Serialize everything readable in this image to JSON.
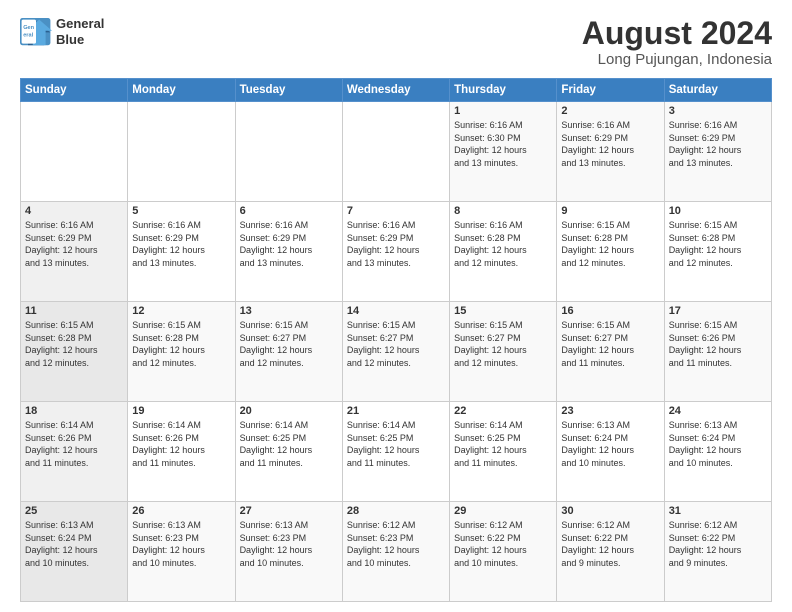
{
  "logo": {
    "line1": "General",
    "line2": "Blue"
  },
  "title": "August 2024",
  "subtitle": "Long Pujungan, Indonesia",
  "days_header": [
    "Sunday",
    "Monday",
    "Tuesday",
    "Wednesday",
    "Thursday",
    "Friday",
    "Saturday"
  ],
  "weeks": [
    [
      {
        "day": "",
        "info": ""
      },
      {
        "day": "",
        "info": ""
      },
      {
        "day": "",
        "info": ""
      },
      {
        "day": "",
        "info": ""
      },
      {
        "day": "1",
        "info": "Sunrise: 6:16 AM\nSunset: 6:30 PM\nDaylight: 12 hours\nand 13 minutes."
      },
      {
        "day": "2",
        "info": "Sunrise: 6:16 AM\nSunset: 6:29 PM\nDaylight: 12 hours\nand 13 minutes."
      },
      {
        "day": "3",
        "info": "Sunrise: 6:16 AM\nSunset: 6:29 PM\nDaylight: 12 hours\nand 13 minutes."
      }
    ],
    [
      {
        "day": "4",
        "info": "Sunrise: 6:16 AM\nSunset: 6:29 PM\nDaylight: 12 hours\nand 13 minutes."
      },
      {
        "day": "5",
        "info": "Sunrise: 6:16 AM\nSunset: 6:29 PM\nDaylight: 12 hours\nand 13 minutes."
      },
      {
        "day": "6",
        "info": "Sunrise: 6:16 AM\nSunset: 6:29 PM\nDaylight: 12 hours\nand 13 minutes."
      },
      {
        "day": "7",
        "info": "Sunrise: 6:16 AM\nSunset: 6:29 PM\nDaylight: 12 hours\nand 13 minutes."
      },
      {
        "day": "8",
        "info": "Sunrise: 6:16 AM\nSunset: 6:28 PM\nDaylight: 12 hours\nand 12 minutes."
      },
      {
        "day": "9",
        "info": "Sunrise: 6:15 AM\nSunset: 6:28 PM\nDaylight: 12 hours\nand 12 minutes."
      },
      {
        "day": "10",
        "info": "Sunrise: 6:15 AM\nSunset: 6:28 PM\nDaylight: 12 hours\nand 12 minutes."
      }
    ],
    [
      {
        "day": "11",
        "info": "Sunrise: 6:15 AM\nSunset: 6:28 PM\nDaylight: 12 hours\nand 12 minutes."
      },
      {
        "day": "12",
        "info": "Sunrise: 6:15 AM\nSunset: 6:28 PM\nDaylight: 12 hours\nand 12 minutes."
      },
      {
        "day": "13",
        "info": "Sunrise: 6:15 AM\nSunset: 6:27 PM\nDaylight: 12 hours\nand 12 minutes."
      },
      {
        "day": "14",
        "info": "Sunrise: 6:15 AM\nSunset: 6:27 PM\nDaylight: 12 hours\nand 12 minutes."
      },
      {
        "day": "15",
        "info": "Sunrise: 6:15 AM\nSunset: 6:27 PM\nDaylight: 12 hours\nand 12 minutes."
      },
      {
        "day": "16",
        "info": "Sunrise: 6:15 AM\nSunset: 6:27 PM\nDaylight: 12 hours\nand 11 minutes."
      },
      {
        "day": "17",
        "info": "Sunrise: 6:15 AM\nSunset: 6:26 PM\nDaylight: 12 hours\nand 11 minutes."
      }
    ],
    [
      {
        "day": "18",
        "info": "Sunrise: 6:14 AM\nSunset: 6:26 PM\nDaylight: 12 hours\nand 11 minutes."
      },
      {
        "day": "19",
        "info": "Sunrise: 6:14 AM\nSunset: 6:26 PM\nDaylight: 12 hours\nand 11 minutes."
      },
      {
        "day": "20",
        "info": "Sunrise: 6:14 AM\nSunset: 6:25 PM\nDaylight: 12 hours\nand 11 minutes."
      },
      {
        "day": "21",
        "info": "Sunrise: 6:14 AM\nSunset: 6:25 PM\nDaylight: 12 hours\nand 11 minutes."
      },
      {
        "day": "22",
        "info": "Sunrise: 6:14 AM\nSunset: 6:25 PM\nDaylight: 12 hours\nand 11 minutes."
      },
      {
        "day": "23",
        "info": "Sunrise: 6:13 AM\nSunset: 6:24 PM\nDaylight: 12 hours\nand 10 minutes."
      },
      {
        "day": "24",
        "info": "Sunrise: 6:13 AM\nSunset: 6:24 PM\nDaylight: 12 hours\nand 10 minutes."
      }
    ],
    [
      {
        "day": "25",
        "info": "Sunrise: 6:13 AM\nSunset: 6:24 PM\nDaylight: 12 hours\nand 10 minutes."
      },
      {
        "day": "26",
        "info": "Sunrise: 6:13 AM\nSunset: 6:23 PM\nDaylight: 12 hours\nand 10 minutes."
      },
      {
        "day": "27",
        "info": "Sunrise: 6:13 AM\nSunset: 6:23 PM\nDaylight: 12 hours\nand 10 minutes."
      },
      {
        "day": "28",
        "info": "Sunrise: 6:12 AM\nSunset: 6:23 PM\nDaylight: 12 hours\nand 10 minutes."
      },
      {
        "day": "29",
        "info": "Sunrise: 6:12 AM\nSunset: 6:22 PM\nDaylight: 12 hours\nand 10 minutes."
      },
      {
        "day": "30",
        "info": "Sunrise: 6:12 AM\nSunset: 6:22 PM\nDaylight: 12 hours\nand 9 minutes."
      },
      {
        "day": "31",
        "info": "Sunrise: 6:12 AM\nSunset: 6:22 PM\nDaylight: 12 hours\nand 9 minutes."
      }
    ]
  ]
}
